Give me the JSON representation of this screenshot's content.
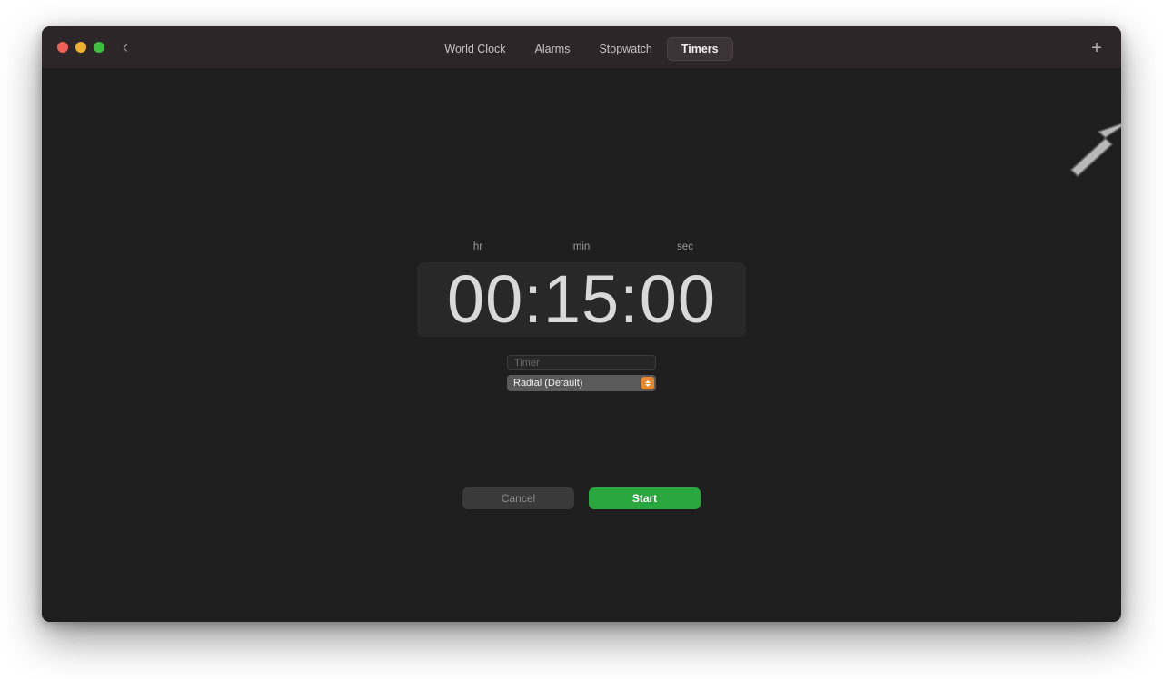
{
  "window": {
    "traffic_lights": [
      {
        "name": "close",
        "color": "#ef5f56"
      },
      {
        "name": "minimize",
        "color": "#f0b02f"
      },
      {
        "name": "zoom",
        "color": "#3bbf3c"
      }
    ],
    "back_icon": "‹",
    "add_icon": "+"
  },
  "tabs": [
    {
      "label": "World Clock",
      "active": false
    },
    {
      "label": "Alarms",
      "active": false
    },
    {
      "label": "Stopwatch",
      "active": false
    },
    {
      "label": "Timers",
      "active": true
    }
  ],
  "timer": {
    "unit_labels": {
      "hr": "hr",
      "min": "min",
      "sec": "sec"
    },
    "value": "00:15:00",
    "hours": "00",
    "minutes": "15",
    "seconds": "00",
    "name_placeholder": "Timer",
    "name_value": "",
    "sound_selected": "Radial (Default)",
    "stepper_icon": "stepper-updown-icon"
  },
  "actions": {
    "cancel_label": "Cancel",
    "cancel_enabled": false,
    "start_label": "Start",
    "start_color": "#2aa63f"
  },
  "cursor": {
    "icon": "arrow-pointer-cursor"
  }
}
